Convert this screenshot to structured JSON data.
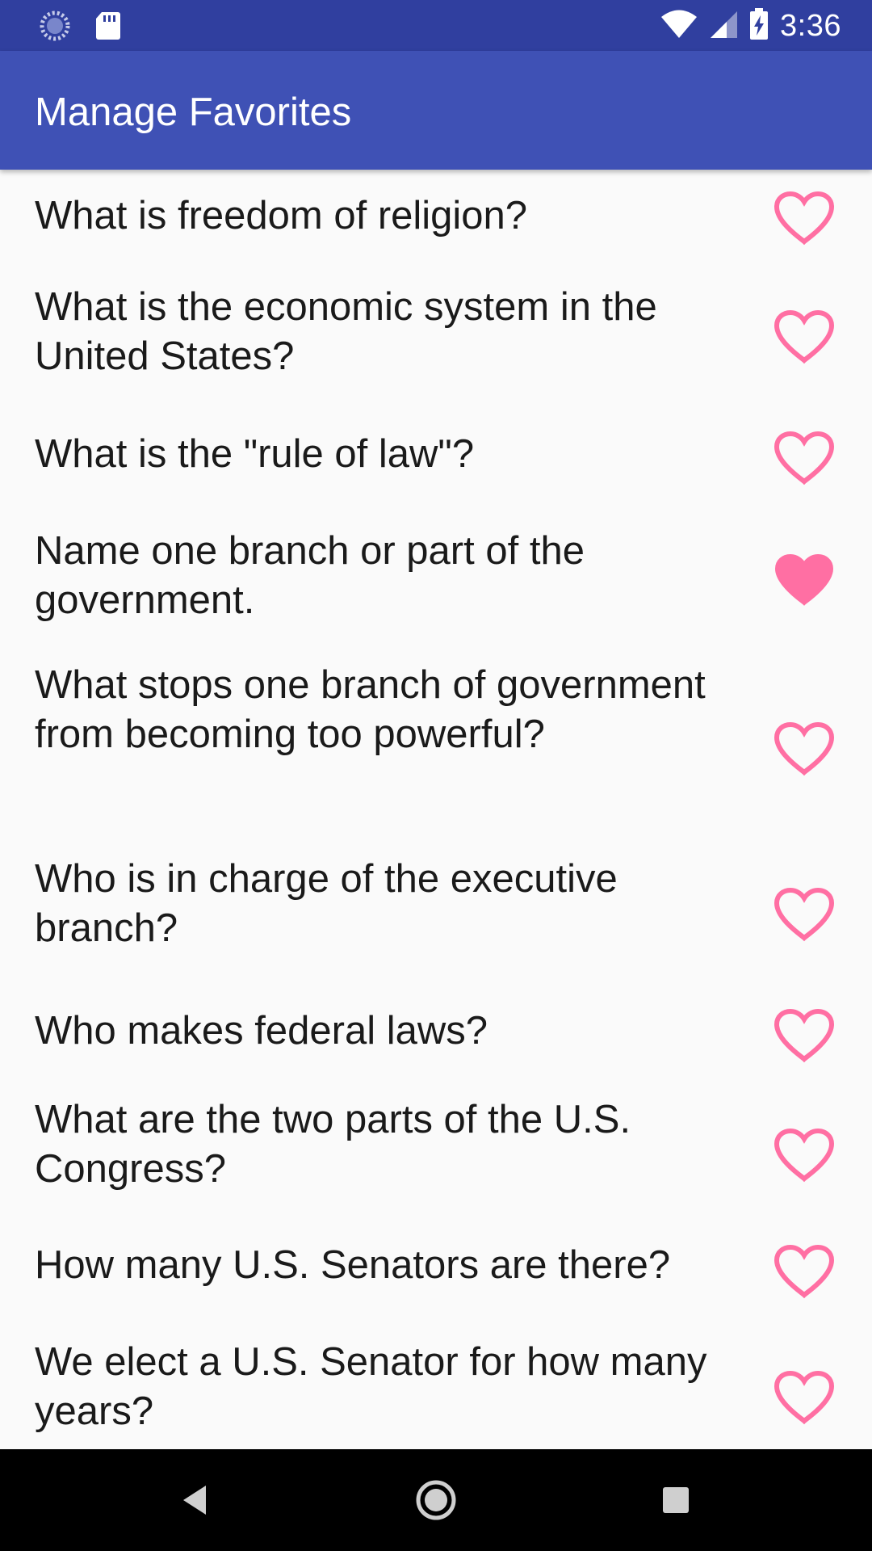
{
  "status_bar": {
    "time": "3:36",
    "icons": [
      "sync-icon",
      "sd-card-icon",
      "wifi-icon",
      "signal-icon",
      "battery-charging-icon"
    ]
  },
  "app_bar": {
    "title": "Manage Favorites"
  },
  "colors": {
    "status_bar": "#303f9f",
    "app_bar": "#3f51b5",
    "heart": "#ff6fa3",
    "background": "#fafafa"
  },
  "questions": [
    {
      "text": "What is freedom of religion?",
      "favorite": false
    },
    {
      "text": "What is the economic system in the United States?",
      "favorite": false
    },
    {
      "text": "What is the \"rule of law\"?",
      "favorite": false
    },
    {
      "text": "Name one branch or part of the government.",
      "favorite": true
    },
    {
      "text": "What stops one branch of government from becoming too powerful?",
      "favorite": false
    },
    {
      "text": "Who is in charge of the executive branch?",
      "favorite": false
    },
    {
      "text": "Who makes federal laws?",
      "favorite": false
    },
    {
      "text": "What are the two parts of the U.S. Congress?",
      "favorite": false
    },
    {
      "text": "How many U.S. Senators are there?",
      "favorite": false
    },
    {
      "text": "We elect a U.S. Senator for how many years?",
      "favorite": false
    }
  ],
  "nav_bar": {
    "buttons": [
      "back-icon",
      "home-icon",
      "recents-icon"
    ]
  }
}
